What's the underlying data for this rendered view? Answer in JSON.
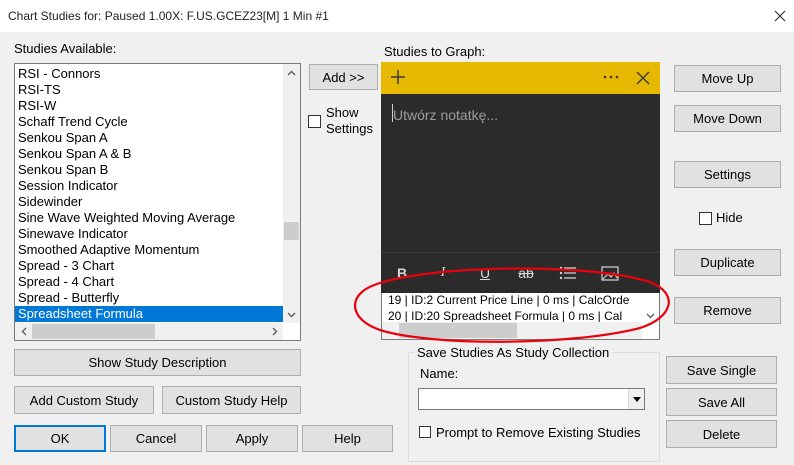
{
  "window": {
    "title": "Chart Studies for: Paused 1.00X: F.US.GCEZ23[M]  1 Min   #1"
  },
  "studies_available": {
    "label": "Studies Available:",
    "items": [
      "RSI - Connors",
      "RSI-TS",
      "RSI-W",
      "Schaff Trend Cycle",
      "Senkou Span A",
      "Senkou Span A & B",
      "Senkou Span B",
      "Session Indicator",
      "Sidewinder",
      "Sine Wave Weighted Moving Average",
      "Sinewave Indicator",
      "Smoothed Adaptive Momentum",
      "Spread - 3 Chart",
      "Spread - 4 Chart",
      "Spread - Butterfly",
      "Spreadsheet Formula"
    ],
    "selected": "Spreadsheet Formula"
  },
  "studies_to_graph": {
    "label": "Studies to Graph:",
    "items": [
      "19 | ID:2  Current Price Line | 0 ms | CalcOrde",
      "20 | ID:20  Spreadsheet Formula | 0 ms | Cal"
    ]
  },
  "center": {
    "add_label": "Add >>",
    "show_settings_label": "Show Settings",
    "show_settings_checked": false
  },
  "right_buttons": {
    "move_up": "Move Up",
    "move_down": "Move Down",
    "settings": "Settings",
    "hide_label": "Hide",
    "hide_checked": false,
    "duplicate": "Duplicate",
    "remove": "Remove"
  },
  "left_buttons": {
    "show_description": "Show Study Description",
    "add_custom": "Add Custom Study",
    "custom_help": "Custom Study Help"
  },
  "bottom_buttons": {
    "ok": "OK",
    "cancel": "Cancel",
    "apply": "Apply",
    "help": "Help"
  },
  "collection": {
    "title": "Save Studies As Study Collection",
    "name_label": "Name:",
    "name_value": "",
    "prompt_label": "Prompt to Remove Existing Studies",
    "prompt_checked": false,
    "save_single": "Save Single",
    "save_all": "Save All",
    "delete": "Delete"
  },
  "sticky_note": {
    "placeholder": "Utwórz notatkę...",
    "header_color": "#e6b800",
    "body_color": "#2b2b2b",
    "toolbar_icons": [
      "plus-icon",
      "more-icon",
      "close-icon"
    ],
    "format_icons": [
      "bold-icon",
      "italic-icon",
      "underline-icon",
      "strikethrough-icon",
      "bullet-list-icon",
      "image-icon"
    ]
  },
  "annotation": {
    "color": "#e8000b"
  }
}
